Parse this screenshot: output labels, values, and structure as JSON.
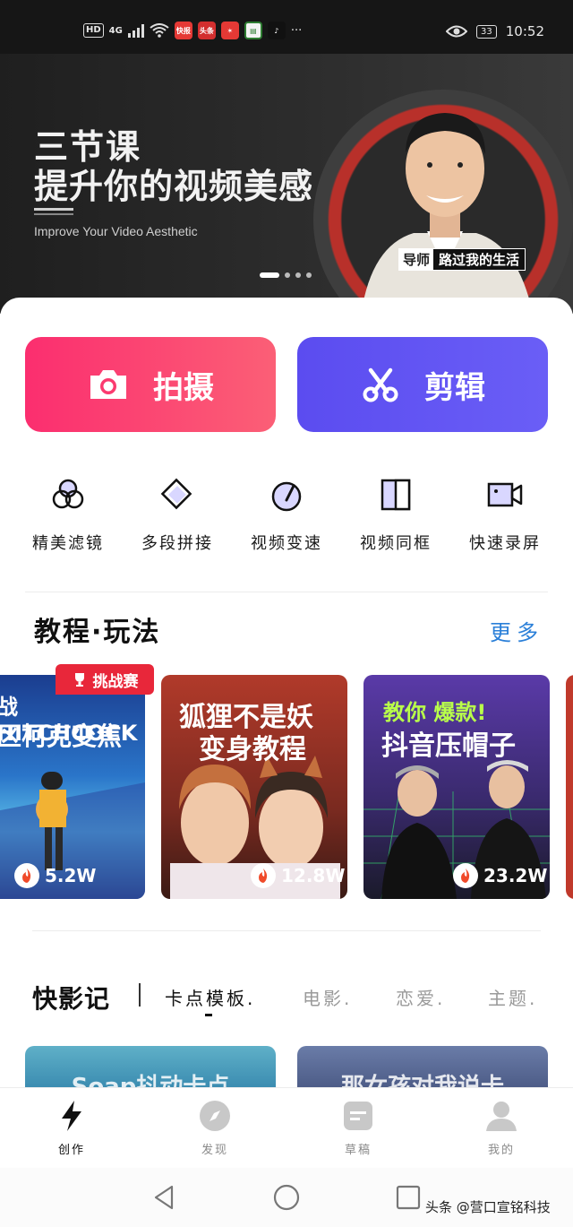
{
  "status_bar": {
    "left_labels": [
      "HD",
      "4G"
    ],
    "app_icons": [
      {
        "name": "kuaibao-icon",
        "label": "快报",
        "color": "#e53935"
      },
      {
        "name": "toutiao-icon",
        "label": "头条",
        "color": "#d32f2f"
      },
      {
        "name": "weibo-icon",
        "label": "",
        "color": "#e53935"
      },
      {
        "name": "read-icon",
        "label": "",
        "color": "#2e7d32"
      },
      {
        "name": "tiktok-icon",
        "label": "",
        "color": "#111111"
      }
    ],
    "more": "···",
    "battery": "33",
    "time": "10:52"
  },
  "banner": {
    "title_line1": "三节课",
    "title_line2": "提升你的视频美感",
    "subtitle": "Improve Your Video Aesthetic",
    "tag_role": "导师",
    "tag_name": "路过我的生活",
    "page_count": 4,
    "active_page": 1
  },
  "actions": {
    "shoot_label": "拍摄",
    "edit_label": "剪辑",
    "shoot_color": "#fb3a6f",
    "edit_color": "#5e50f2"
  },
  "tools": [
    {
      "label": "精美滤镜",
      "icon": "filter-icon"
    },
    {
      "label": "多段拼接",
      "icon": "splice-icon"
    },
    {
      "label": "视频变速",
      "icon": "speed-icon"
    },
    {
      "label": "视频同框",
      "icon": "duet-icon"
    },
    {
      "label": "快速录屏",
      "icon": "screen-record-icon"
    }
  ],
  "tutorials": {
    "title": "教程·玩法",
    "more": "更多",
    "badge": "挑战赛",
    "cards": [
      {
        "title_line1": "战 HITCHCOCK",
        "title_line2": "区柯克变焦",
        "views": "5.2W"
      },
      {
        "title_line1": "狐狸不是妖",
        "title_line2": "变身教程",
        "views": "12.8W"
      },
      {
        "title_line1": "教你 爆款!",
        "title_line2": "抖音压帽子",
        "views": "23.2W"
      }
    ]
  },
  "kuaiyingji": {
    "title": "快影记",
    "tabs": [
      {
        "label": "卡点模板.",
        "active": true
      },
      {
        "label": "电影.",
        "active": false
      },
      {
        "label": "恋爱.",
        "active": false
      },
      {
        "label": "主题.",
        "active": false
      }
    ],
    "cards": [
      {
        "title": "Soap抖动卡点"
      },
      {
        "title": "那女孩对我说卡"
      }
    ]
  },
  "tab_bar": [
    {
      "label": "创作",
      "icon": "lightning-icon",
      "active": true
    },
    {
      "label": "发现",
      "icon": "compass-icon",
      "active": false
    },
    {
      "label": "草稿",
      "icon": "draft-icon",
      "active": false
    },
    {
      "label": "我的",
      "icon": "profile-icon",
      "active": false
    }
  ],
  "watermark": "头条 @营口宣铭科技"
}
